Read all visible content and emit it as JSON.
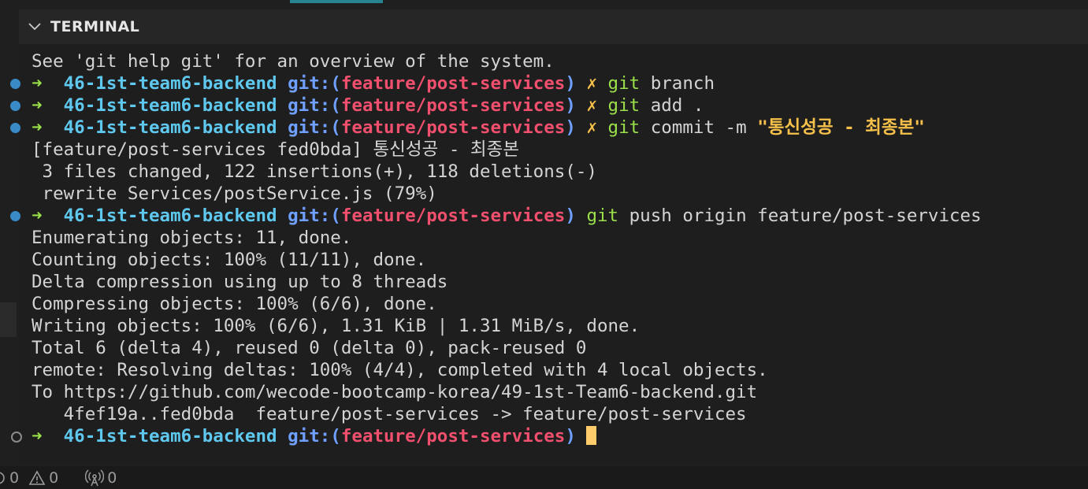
{
  "panel": {
    "title": "TERMINAL"
  },
  "terminal": {
    "lines": [
      {
        "kind": "output",
        "text": "See 'git help git' for an overview of the system."
      },
      {
        "kind": "prompt",
        "dot": "filled",
        "arrow": "➜",
        "dir": "46-1st-team6-backend",
        "git_label": "git:(",
        "branch": "feature/post-services",
        "git_close": ")",
        "dirty": "✗",
        "cmd": "git",
        "args": "branch",
        "string": ""
      },
      {
        "kind": "prompt",
        "dot": "filled",
        "arrow": "➜",
        "dir": "46-1st-team6-backend",
        "git_label": "git:(",
        "branch": "feature/post-services",
        "git_close": ")",
        "dirty": "✗",
        "cmd": "git",
        "args": "add .",
        "string": ""
      },
      {
        "kind": "prompt",
        "dot": "filled",
        "arrow": "➜",
        "dir": "46-1st-team6-backend",
        "git_label": "git:(",
        "branch": "feature/post-services",
        "git_close": ")",
        "dirty": "✗",
        "cmd": "git",
        "args": "commit -m",
        "string": "\"통신성공 - 최종본\""
      },
      {
        "kind": "output",
        "text": "[feature/post-services fed0bda] 통신성공 - 최종본"
      },
      {
        "kind": "output",
        "text": " 3 files changed, 122 insertions(+), 118 deletions(-)"
      },
      {
        "kind": "output",
        "text": " rewrite Services/postService.js (79%)"
      },
      {
        "kind": "prompt",
        "dot": "filled",
        "arrow": "➜",
        "dir": "46-1st-team6-backend",
        "git_label": "git:(",
        "branch": "feature/post-services",
        "git_close": ")",
        "dirty": "",
        "cmd": "git",
        "args": "push origin feature/post-services",
        "string": ""
      },
      {
        "kind": "output",
        "text": "Enumerating objects: 11, done."
      },
      {
        "kind": "output",
        "text": "Counting objects: 100% (11/11), done."
      },
      {
        "kind": "output",
        "text": "Delta compression using up to 8 threads"
      },
      {
        "kind": "output",
        "text": "Compressing objects: 100% (6/6), done."
      },
      {
        "kind": "output",
        "text": "Writing objects: 100% (6/6), 1.31 KiB | 1.31 MiB/s, done."
      },
      {
        "kind": "output",
        "text": "Total 6 (delta 4), reused 0 (delta 0), pack-reused 0"
      },
      {
        "kind": "output",
        "text": "remote: Resolving deltas: 100% (4/4), completed with 4 local objects."
      },
      {
        "kind": "output",
        "text": "To https://github.com/wecode-bootcamp-korea/49-1st-Team6-backend.git"
      },
      {
        "kind": "output",
        "text": "   4fef19a..fed0bda  feature/post-services -> feature/post-services"
      },
      {
        "kind": "prompt",
        "dot": "hollow",
        "arrow": "➜",
        "dir": "46-1st-team6-backend",
        "git_label": "git:(",
        "branch": "feature/post-services",
        "git_close": ")",
        "dirty": "",
        "cmd": "",
        "args": "",
        "string": "",
        "cursor": true
      }
    ]
  },
  "statusbar": {
    "errors": "0",
    "warnings": "0",
    "ports": "0"
  }
}
